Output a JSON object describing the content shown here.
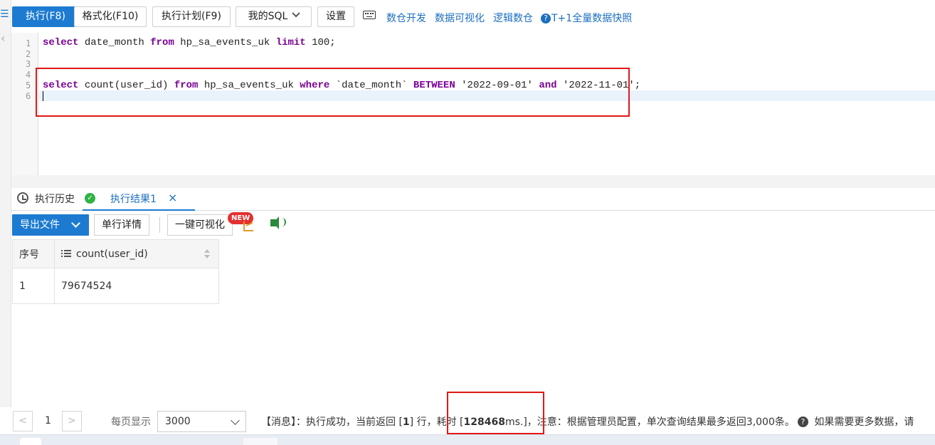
{
  "toolbar": {
    "run": "执行(F8)",
    "format": "格式化(F10)",
    "plan": "执行计划(F9)",
    "my_sql": "我的SQL",
    "settings": "设置",
    "links": [
      "数仓开发",
      "数据可视化",
      "逻辑数仓",
      "T+1全量数据快照"
    ]
  },
  "editor": {
    "line_numbers": [
      "1",
      "2",
      "3",
      "4",
      "5",
      "6"
    ],
    "line1": {
      "k1": "select",
      "t1": " date_month ",
      "k2": "from",
      "t2": " hp_sa_events_uk ",
      "k3": "limit",
      "t3": " 100;"
    },
    "line5": {
      "k1": "select",
      "t1": " count(user_id) ",
      "k2": "from",
      "t2": " hp_sa_events_uk ",
      "k3": "where",
      "t3": " `date_month` ",
      "k4": "BETWEEN",
      "t4": " '2022-09-01' ",
      "k5": "and",
      "t5": " '2022-11-01';"
    }
  },
  "tabs": {
    "history": "执行历史",
    "result": "执行结果1",
    "close": "×"
  },
  "result_toolbar": {
    "export": "导出文件",
    "row_detail": "单行详情",
    "visualize": "一键可视化",
    "new_badge": "NEW"
  },
  "table": {
    "headers": [
      "序号",
      "count(user_id)"
    ],
    "rows": [
      [
        "1",
        "79674524"
      ]
    ]
  },
  "footer": {
    "prev": "<",
    "page": "1",
    "next": ">",
    "per_page_label": "每页显示",
    "per_page_value": "3000",
    "msg_prefix": "【消息】：执行成功，当前返回 [",
    "rows_returned": "1",
    "msg_mid": "] 行，耗时 [",
    "elapsed": "128468",
    "msg_ms": "ms.]，注意：根据管理员配置，单次查询结果最多返回3,000条。",
    "msg_tail": "如果需要更多数据，请"
  },
  "colors": {
    "primary": "#1c7bd0",
    "link": "#1c6fc0",
    "keyword": "#7a0094",
    "highlight_box": "#e01818",
    "success": "#2fb344"
  }
}
